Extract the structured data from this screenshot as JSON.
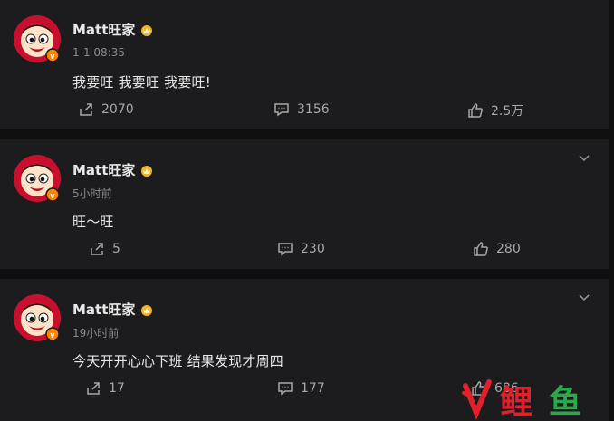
{
  "posts": [
    {
      "username": "Matt旺家",
      "time": "1-1 08:35",
      "text": "我要旺 我要旺 我要旺!",
      "shares": "2070",
      "comments": "3156",
      "likes": "2.5万",
      "has_menu": false
    },
    {
      "username": "Matt旺家",
      "time": "5小时前",
      "text": "旺～旺",
      "shares": "5",
      "comments": "230",
      "likes": "280",
      "has_menu": true
    },
    {
      "username": "Matt旺家",
      "time": "19小时前",
      "text": "今天开开心心下班 结果发现才周四",
      "shares": "17",
      "comments": "177",
      "likes": "686",
      "has_menu": true
    }
  ],
  "watermark": {
    "text": "鲤鱼"
  },
  "colors": {
    "background": "#0f0f0f",
    "card": "#1c1c1e",
    "accent_gold": "#f0b429",
    "avatar_red": "#c8102e",
    "verified_orange": "#ff8200",
    "watermark_red": "#e0202a",
    "watermark_green": "#2aa84a"
  },
  "icons": [
    "share-icon",
    "comment-icon",
    "like-icon",
    "chevron-down-icon",
    "crown-badge-icon",
    "verified-icon"
  ]
}
